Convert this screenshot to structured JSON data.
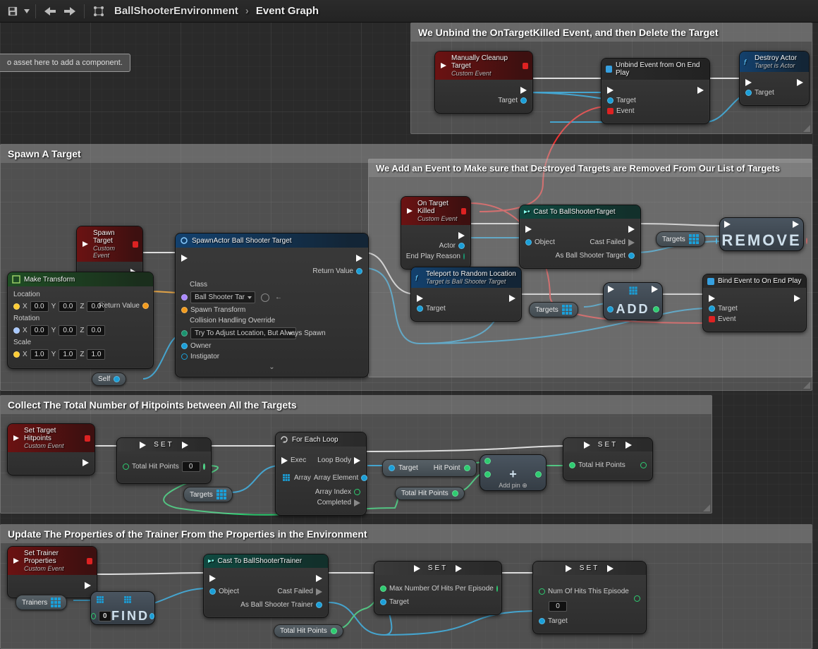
{
  "toolbar": {
    "breadcrumb1": "BallShooterEnvironment",
    "breadcrumb2": "Event Graph"
  },
  "dropPrompt": "o asset here to add a component.",
  "comments": {
    "unbind": "We Unbind the OnTargetKilled Event, and then Delete the Target",
    "spawn": "Spawn A Target",
    "addEvt": "We Add an Event to Make sure that Destroyed Targets are Removed From Our List of Targets",
    "collect": "Collect The Total Number of Hitpoints between All the Targets",
    "update": "Update The Properties of the Trainer From the Properties in the Environment"
  },
  "nodes": {
    "manualCleanup": {
      "title": "Manually Cleanup Target",
      "sub": "Custom Event",
      "pin_target": "Target"
    },
    "unbindEvt": {
      "title": "Unbind Event from On End Play",
      "pin_target": "Target",
      "pin_event": "Event"
    },
    "destroy": {
      "title": "Destroy Actor",
      "sub": "Target is Actor",
      "pin_target": "Target"
    },
    "spawnTarget": {
      "title": "Spawn Target",
      "sub": "Custom Event"
    },
    "makeTransform": {
      "title": "Make Transform",
      "loc": "Location",
      "rot": "Rotation",
      "scale": "Scale",
      "rv": "Return Value",
      "x": "X",
      "y": "Y",
      "z": "Z",
      "vals0": "0.0",
      "vals1": "1.0"
    },
    "spawnActor": {
      "title": "SpawnActor Ball Shooter Target",
      "class": "Class",
      "class_val": "Ball Shooter Tar",
      "st": "Spawn Transform",
      "cho": "Collision Handling Override",
      "cho_val": "Try To Adjust Location, But Always Spawn",
      "owner": "Owner",
      "instigator": "Instigator",
      "rv": "Return Value"
    },
    "self": "Self",
    "onTargetKilled": {
      "title": "On Target Killed",
      "sub": "Custom Event",
      "actor": "Actor",
      "epr": "End Play Reason"
    },
    "castTarget": {
      "title": "Cast To BallShooterTarget",
      "obj": "Object",
      "fail": "Cast Failed",
      "as": "As Ball Shooter Target"
    },
    "teleport": {
      "title": "Teleport to Random Location",
      "sub": "Target is Ball Shooter Target",
      "target": "Target"
    },
    "targets": "Targets",
    "add": "ADD",
    "remove": "REMOVE",
    "bind": {
      "title": "Bind Event to On End Play",
      "target": "Target",
      "event": "Event"
    },
    "setHitpoints": {
      "title": "Set Target Hitpoints",
      "sub": "Custom Event"
    },
    "set": "SET",
    "thp": "Total Hit Points",
    "foreach": {
      "title": "For Each Loop",
      "exec": "Exec",
      "arr": "Array",
      "body": "Loop Body",
      "elem": "Array Element",
      "idx": "Array Index",
      "done": "Completed"
    },
    "target": "Target",
    "hitpoint": "Hit Point",
    "addpin": "Add pin",
    "setTrainer": {
      "title": "Set Trainer Properties",
      "sub": "Custom Event"
    },
    "castTrainer": {
      "title": "Cast To BallShooterTrainer",
      "obj": "Object",
      "fail": "Cast Failed",
      "as": "As Ball Shooter Trainer"
    },
    "maxHits": "Max Number Of Hits Per Episode",
    "numHits": "Num Of Hits This Episode",
    "zero": "0",
    "trainers": "Trainers",
    "find": "FIND"
  }
}
